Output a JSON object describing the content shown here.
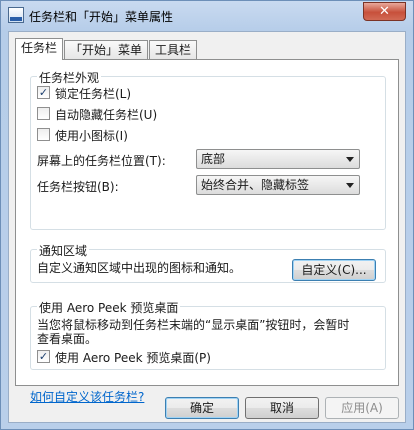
{
  "window": {
    "title": "任务栏和「开始」菜单属性",
    "close_label": "✕"
  },
  "tabs": [
    {
      "label": "任务栏"
    },
    {
      "label": "「开始」菜单"
    },
    {
      "label": "工具栏"
    }
  ],
  "appearance": {
    "title": "任务栏外观",
    "lock_taskbar": {
      "label": "锁定任务栏(L)",
      "checked": true
    },
    "autohide": {
      "label": "自动隐藏任务栏(U)",
      "checked": false
    },
    "small_icons": {
      "label": "使用小图标(I)",
      "checked": false
    },
    "location_label": "屏幕上的任务栏位置(T):",
    "location_value": "底部",
    "buttons_label": "任务栏按钮(B):",
    "buttons_value": "始终合并、隐藏标签"
  },
  "notification": {
    "title": "通知区域",
    "description": "自定义通知区域中出现的图标和通知。",
    "customize_button": "自定义(C)..."
  },
  "aero_peek": {
    "title": "使用 Aero Peek 预览桌面",
    "description_line1": "当您将鼠标移动到任务栏末端的“显示桌面”按钮时，会暂时",
    "description_line2": "查看桌面。",
    "checkbox": {
      "label": "使用 Aero Peek 预览桌面(P)",
      "checked": true
    }
  },
  "help_link": "如何自定义该任务栏?",
  "footer": {
    "ok": "确定",
    "cancel": "取消",
    "apply": "应用(A)"
  },
  "colors": {
    "annotation_arrow": "#e53a2f",
    "link": "#0066cc"
  },
  "check_mark": "✓"
}
